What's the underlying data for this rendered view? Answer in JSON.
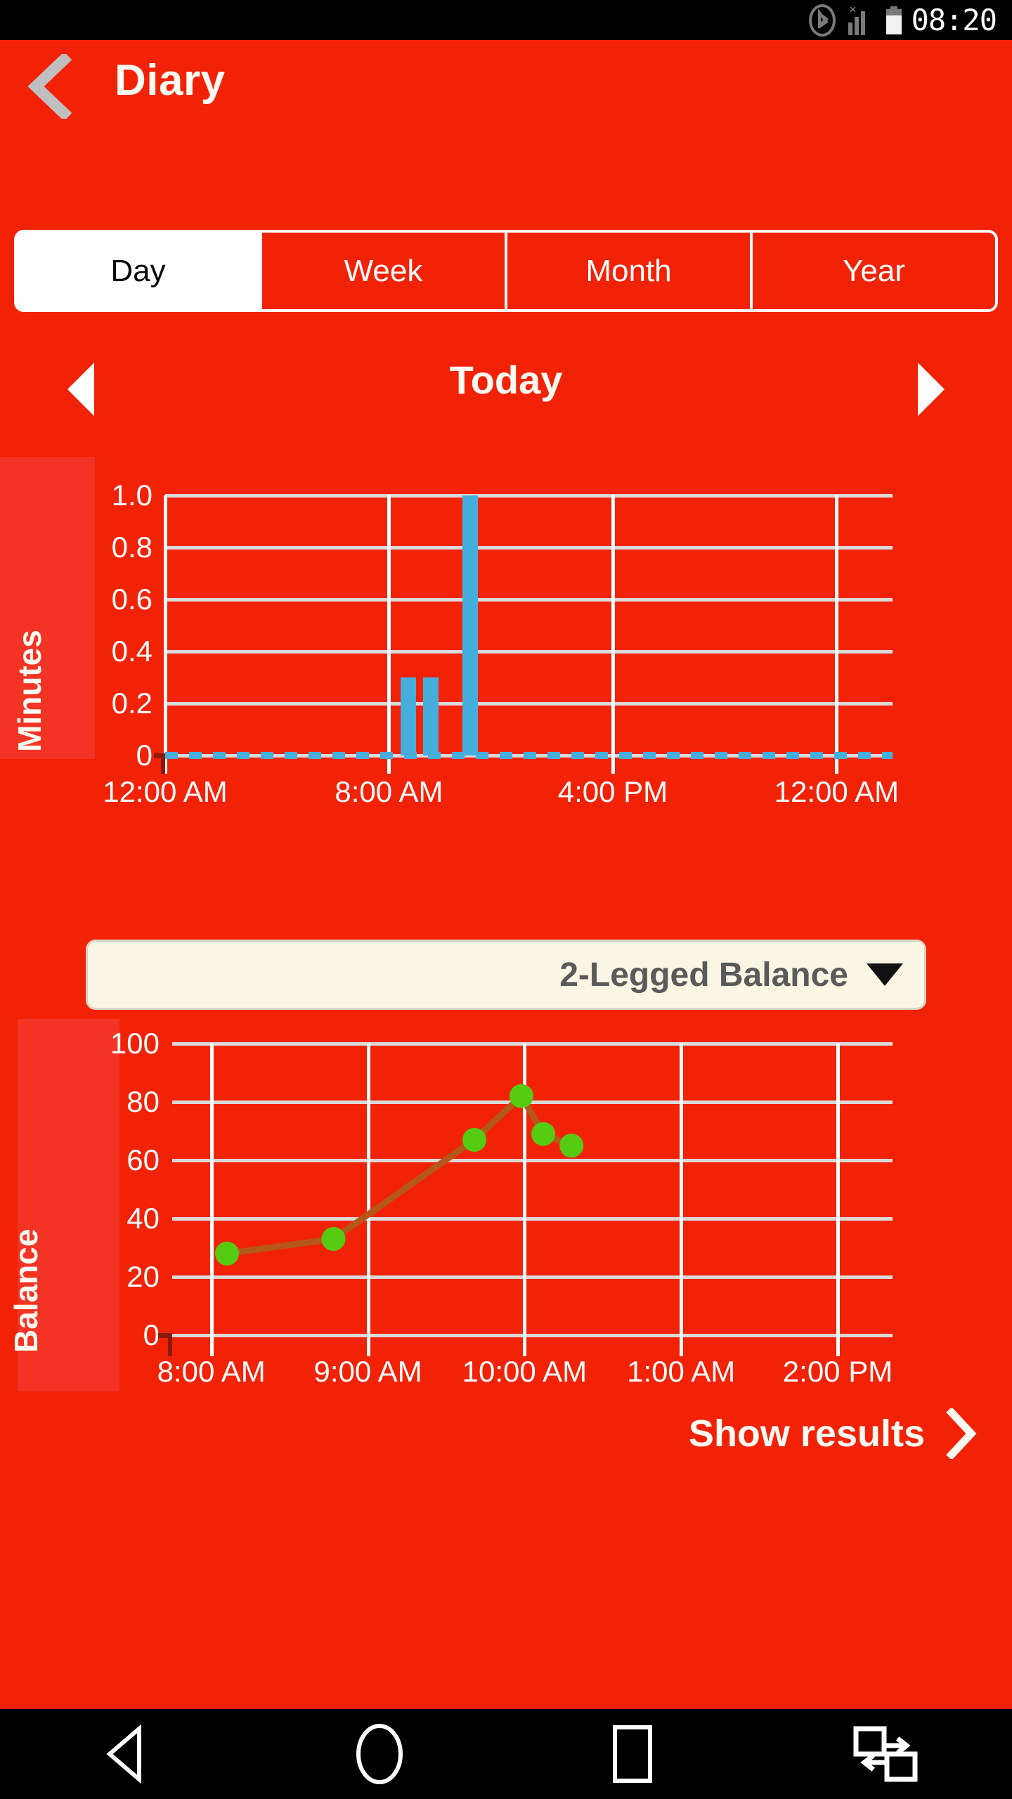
{
  "status_bar": {
    "time": "08:20",
    "icons": [
      "bluetooth-icon",
      "signal-no-sim-icon",
      "battery-icon"
    ]
  },
  "app_bar": {
    "back_icon": "chevron-left-icon",
    "title": "Diary"
  },
  "period_tabs": {
    "selected": "Day",
    "items": [
      {
        "label": "Day"
      },
      {
        "label": "Week"
      },
      {
        "label": "Month"
      },
      {
        "label": "Year"
      }
    ]
  },
  "date_nav": {
    "prev_icon": "triangle-left-icon",
    "label": "Today",
    "next_icon": "triangle-right-icon"
  },
  "metric_select": {
    "value": "2-Legged Balance",
    "caret_icon": "chevron-down-icon"
  },
  "show_results": {
    "label": "Show results",
    "chevron_icon": "chevron-right-icon"
  },
  "nav_bar": {
    "items": [
      {
        "icon": "back-triangle-icon"
      },
      {
        "icon": "home-circle-icon"
      },
      {
        "icon": "recents-square-icon"
      },
      {
        "icon": "split-screen-swap-icon"
      }
    ]
  },
  "colors": {
    "background_red": "#F22207",
    "card_red": "#F33424",
    "bar_blue": "#45AEDD",
    "line_green": "#55CC11",
    "line_stroke": "#B4581A",
    "grid_white": "#FFFFFF",
    "dropdown_cream": "#FBF6E3",
    "tab_active_bg": "#FFFFFF"
  },
  "chart_data": [
    {
      "type": "bar",
      "title": "",
      "xlabel": "",
      "ylabel": "Minutes",
      "ylim": [
        0,
        1.0
      ],
      "yticks": [
        "0",
        "0.2",
        "0.4",
        "0.6",
        "0.8",
        "1.0"
      ],
      "ytick_values": [
        0,
        0.2,
        0.4,
        0.6,
        0.8,
        1.0
      ],
      "xticks": [
        "12:00 AM",
        "8:00 AM",
        "4:00 PM",
        "12:00 AM"
      ],
      "xtick_positions": [
        0,
        8,
        16,
        24
      ],
      "xlim": [
        0,
        26
      ],
      "grid": true,
      "legend": "none",
      "baseline_style": "dashed-blue",
      "x": [
        8.7,
        9.5,
        10.9
      ],
      "values": [
        0.3,
        0.3,
        1.0
      ],
      "bar_color": "#45AEDD"
    },
    {
      "type": "line",
      "title": "",
      "xlabel": "",
      "ylabel": "Balance",
      "ylim": [
        0,
        100
      ],
      "yticks": [
        "0",
        "20",
        "40",
        "60",
        "80",
        "100"
      ],
      "ytick_values": [
        0,
        20,
        40,
        60,
        80,
        100
      ],
      "xticks": [
        "8:00 AM",
        "9:00 AM",
        "10:00 AM",
        "1:00 AM",
        "2:00 PM"
      ],
      "xtick_positions": [
        0,
        1,
        2,
        3,
        4
      ],
      "xlim": [
        -0.25,
        4.35
      ],
      "grid": true,
      "legend": "none",
      "marker": "circle",
      "marker_color": "#55CC11",
      "line_color": "#B4581A",
      "x": [
        0.1,
        0.78,
        1.68,
        1.98,
        2.12,
        2.3
      ],
      "values": [
        28,
        33,
        67,
        82,
        69,
        65
      ]
    }
  ]
}
